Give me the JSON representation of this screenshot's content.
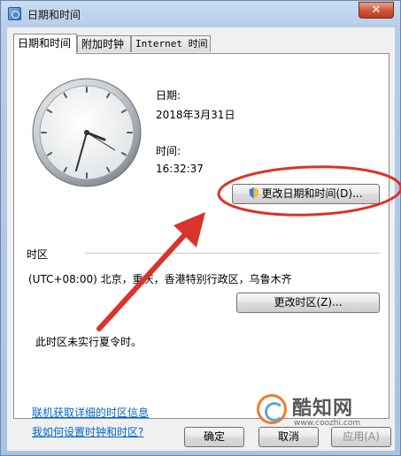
{
  "window": {
    "title": "日期和时间",
    "close_glyph": "✕"
  },
  "tabs": [
    {
      "label": "日期和时间",
      "active": true
    },
    {
      "label": "附加时钟",
      "active": false
    },
    {
      "label": "Internet 时间",
      "active": false
    }
  ],
  "datetime": {
    "date_label": "日期:",
    "date_value": "2018年3月31日",
    "time_label": "时间:",
    "time_value": "16:32:37",
    "change_button": "更改日期和时间(D)..."
  },
  "timezone": {
    "header": "时区",
    "value": "(UTC+08:00) 北京，重庆，香港特别行政区，乌鲁木齐",
    "change_button": "更改时区(Z)...",
    "dst_note": "此时区未实行夏令时。"
  },
  "links": [
    "联机获取详细的时区信息",
    "我如何设置时钟和时区?"
  ],
  "footer": {
    "ok": "确定",
    "cancel": "取消",
    "apply": "应用(A)"
  },
  "watermark": {
    "brand": "酷知网",
    "url": "www.coozhi.com"
  },
  "colors": {
    "link": "#0066cc",
    "annotation": "#d9342b",
    "window_frame": "#b7cde8"
  }
}
